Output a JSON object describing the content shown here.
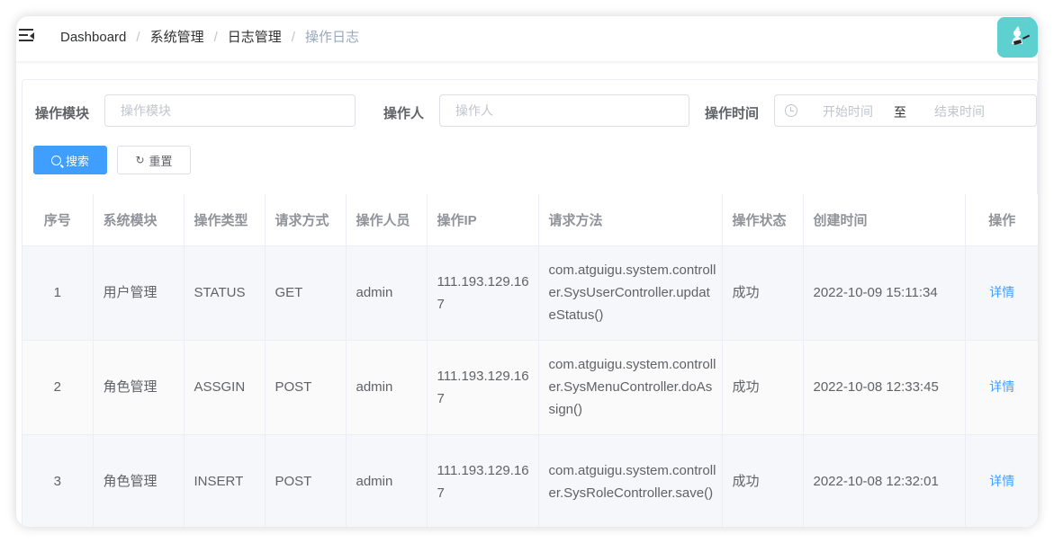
{
  "breadcrumb": [
    "Dashboard",
    "系统管理",
    "日志管理",
    "操作日志"
  ],
  "breadcrumb_separator": "/",
  "search": {
    "module_label": "操作模块",
    "module_placeholder": "操作模块",
    "operator_label": "操作人",
    "operator_placeholder": "操作人",
    "time_label": "操作时间",
    "start_placeholder": "开始时间",
    "range_separator": "至",
    "end_placeholder": "结束时间",
    "search_button": "搜索",
    "reset_button": "重置"
  },
  "table": {
    "columns": [
      "序号",
      "系统模块",
      "操作类型",
      "请求方式",
      "操作人员",
      "操作IP",
      "请求方法",
      "操作状态",
      "创建时间",
      "操作"
    ],
    "rows": [
      {
        "index": "1",
        "module": "用户管理",
        "type": "STATUS",
        "method": "GET",
        "operator": "admin",
        "ip": "111.193.129.167",
        "request_method": "com.atguigu.system.controller.SysUserController.updateStatus()",
        "status": "成功",
        "created": "2022-10-09 15:11:34",
        "action": "详情"
      },
      {
        "index": "2",
        "module": "角色管理",
        "type": "ASSGIN",
        "method": "POST",
        "operator": "admin",
        "ip": "111.193.129.167",
        "request_method": "com.atguigu.system.controller.SysMenuController.doAssign()",
        "status": "成功",
        "created": "2022-10-08 12:33:45",
        "action": "详情"
      },
      {
        "index": "3",
        "module": "角色管理",
        "type": "INSERT",
        "method": "POST",
        "operator": "admin",
        "ip": "111.193.129.167",
        "request_method": "com.atguigu.system.controller.SysRoleController.save()",
        "status": "成功",
        "created": "2022-10-08 12:32:01",
        "action": "详情"
      }
    ]
  },
  "colors": {
    "primary": "#409eff",
    "breadcrumb_active": "#97a8be",
    "avatar_bg": "#5fd0d0"
  },
  "icons": {
    "hamburger": "menu-fold-icon",
    "search": "search-icon",
    "reset": "refresh-icon",
    "time": "clock-icon",
    "avatar": "user-avatar"
  }
}
